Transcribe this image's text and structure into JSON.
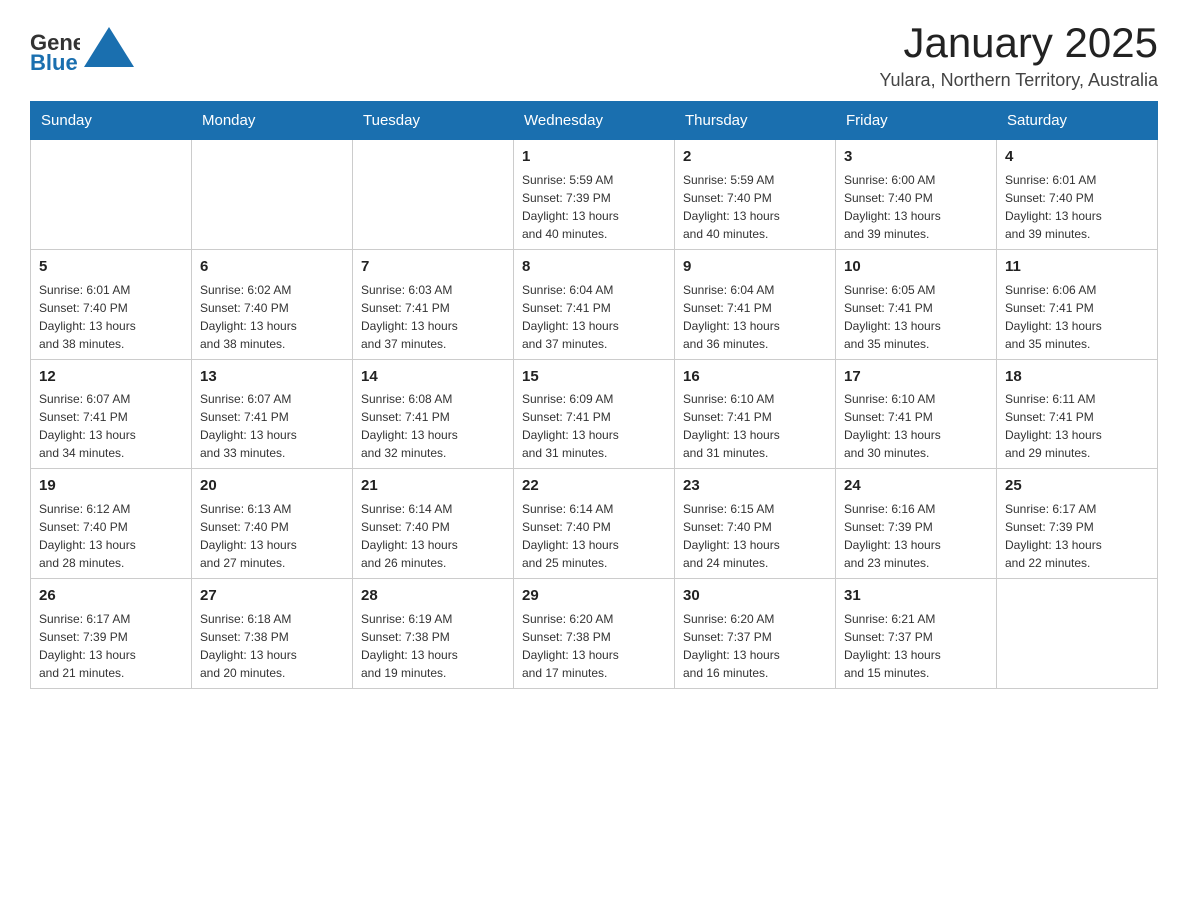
{
  "header": {
    "logo": {
      "general": "General",
      "blue": "Blue"
    },
    "title": "January 2025",
    "location": "Yulara, Northern Territory, Australia"
  },
  "columns": [
    "Sunday",
    "Monday",
    "Tuesday",
    "Wednesday",
    "Thursday",
    "Friday",
    "Saturday"
  ],
  "weeks": [
    [
      {
        "day": "",
        "info": ""
      },
      {
        "day": "",
        "info": ""
      },
      {
        "day": "",
        "info": ""
      },
      {
        "day": "1",
        "info": "Sunrise: 5:59 AM\nSunset: 7:39 PM\nDaylight: 13 hours\nand 40 minutes."
      },
      {
        "day": "2",
        "info": "Sunrise: 5:59 AM\nSunset: 7:40 PM\nDaylight: 13 hours\nand 40 minutes."
      },
      {
        "day": "3",
        "info": "Sunrise: 6:00 AM\nSunset: 7:40 PM\nDaylight: 13 hours\nand 39 minutes."
      },
      {
        "day": "4",
        "info": "Sunrise: 6:01 AM\nSunset: 7:40 PM\nDaylight: 13 hours\nand 39 minutes."
      }
    ],
    [
      {
        "day": "5",
        "info": "Sunrise: 6:01 AM\nSunset: 7:40 PM\nDaylight: 13 hours\nand 38 minutes."
      },
      {
        "day": "6",
        "info": "Sunrise: 6:02 AM\nSunset: 7:40 PM\nDaylight: 13 hours\nand 38 minutes."
      },
      {
        "day": "7",
        "info": "Sunrise: 6:03 AM\nSunset: 7:41 PM\nDaylight: 13 hours\nand 37 minutes."
      },
      {
        "day": "8",
        "info": "Sunrise: 6:04 AM\nSunset: 7:41 PM\nDaylight: 13 hours\nand 37 minutes."
      },
      {
        "day": "9",
        "info": "Sunrise: 6:04 AM\nSunset: 7:41 PM\nDaylight: 13 hours\nand 36 minutes."
      },
      {
        "day": "10",
        "info": "Sunrise: 6:05 AM\nSunset: 7:41 PM\nDaylight: 13 hours\nand 35 minutes."
      },
      {
        "day": "11",
        "info": "Sunrise: 6:06 AM\nSunset: 7:41 PM\nDaylight: 13 hours\nand 35 minutes."
      }
    ],
    [
      {
        "day": "12",
        "info": "Sunrise: 6:07 AM\nSunset: 7:41 PM\nDaylight: 13 hours\nand 34 minutes."
      },
      {
        "day": "13",
        "info": "Sunrise: 6:07 AM\nSunset: 7:41 PM\nDaylight: 13 hours\nand 33 minutes."
      },
      {
        "day": "14",
        "info": "Sunrise: 6:08 AM\nSunset: 7:41 PM\nDaylight: 13 hours\nand 32 minutes."
      },
      {
        "day": "15",
        "info": "Sunrise: 6:09 AM\nSunset: 7:41 PM\nDaylight: 13 hours\nand 31 minutes."
      },
      {
        "day": "16",
        "info": "Sunrise: 6:10 AM\nSunset: 7:41 PM\nDaylight: 13 hours\nand 31 minutes."
      },
      {
        "day": "17",
        "info": "Sunrise: 6:10 AM\nSunset: 7:41 PM\nDaylight: 13 hours\nand 30 minutes."
      },
      {
        "day": "18",
        "info": "Sunrise: 6:11 AM\nSunset: 7:41 PM\nDaylight: 13 hours\nand 29 minutes."
      }
    ],
    [
      {
        "day": "19",
        "info": "Sunrise: 6:12 AM\nSunset: 7:40 PM\nDaylight: 13 hours\nand 28 minutes."
      },
      {
        "day": "20",
        "info": "Sunrise: 6:13 AM\nSunset: 7:40 PM\nDaylight: 13 hours\nand 27 minutes."
      },
      {
        "day": "21",
        "info": "Sunrise: 6:14 AM\nSunset: 7:40 PM\nDaylight: 13 hours\nand 26 minutes."
      },
      {
        "day": "22",
        "info": "Sunrise: 6:14 AM\nSunset: 7:40 PM\nDaylight: 13 hours\nand 25 minutes."
      },
      {
        "day": "23",
        "info": "Sunrise: 6:15 AM\nSunset: 7:40 PM\nDaylight: 13 hours\nand 24 minutes."
      },
      {
        "day": "24",
        "info": "Sunrise: 6:16 AM\nSunset: 7:39 PM\nDaylight: 13 hours\nand 23 minutes."
      },
      {
        "day": "25",
        "info": "Sunrise: 6:17 AM\nSunset: 7:39 PM\nDaylight: 13 hours\nand 22 minutes."
      }
    ],
    [
      {
        "day": "26",
        "info": "Sunrise: 6:17 AM\nSunset: 7:39 PM\nDaylight: 13 hours\nand 21 minutes."
      },
      {
        "day": "27",
        "info": "Sunrise: 6:18 AM\nSunset: 7:38 PM\nDaylight: 13 hours\nand 20 minutes."
      },
      {
        "day": "28",
        "info": "Sunrise: 6:19 AM\nSunset: 7:38 PM\nDaylight: 13 hours\nand 19 minutes."
      },
      {
        "day": "29",
        "info": "Sunrise: 6:20 AM\nSunset: 7:38 PM\nDaylight: 13 hours\nand 17 minutes."
      },
      {
        "day": "30",
        "info": "Sunrise: 6:20 AM\nSunset: 7:37 PM\nDaylight: 13 hours\nand 16 minutes."
      },
      {
        "day": "31",
        "info": "Sunrise: 6:21 AM\nSunset: 7:37 PM\nDaylight: 13 hours\nand 15 minutes."
      },
      {
        "day": "",
        "info": ""
      }
    ]
  ]
}
